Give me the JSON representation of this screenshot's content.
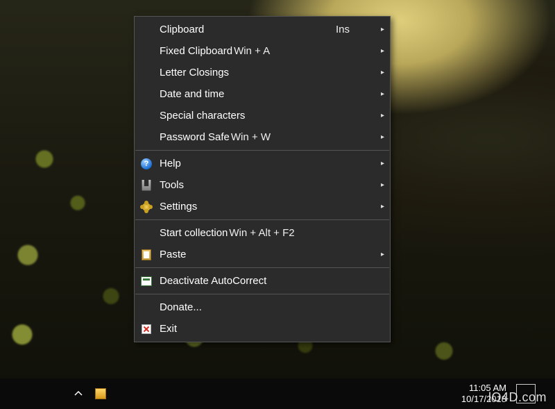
{
  "menu": {
    "items": [
      {
        "label": "Clipboard",
        "shortcut": "Ins",
        "submenu": true,
        "icon": null
      },
      {
        "label": "Fixed Clipboard",
        "shortcut": "Win + A",
        "submenu": true,
        "icon": null
      },
      {
        "label": "Letter Closings",
        "shortcut": "",
        "submenu": true,
        "icon": null
      },
      {
        "label": "Date and time",
        "shortcut": "",
        "submenu": true,
        "icon": null
      },
      {
        "label": "Special characters",
        "shortcut": "",
        "submenu": true,
        "icon": null
      },
      {
        "label": "Password Safe",
        "shortcut": "Win + W",
        "submenu": true,
        "icon": null
      }
    ],
    "items2": [
      {
        "label": "Help",
        "shortcut": "",
        "submenu": true,
        "icon": "help"
      },
      {
        "label": "Tools",
        "shortcut": "",
        "submenu": true,
        "icon": "tools"
      },
      {
        "label": "Settings",
        "shortcut": "",
        "submenu": true,
        "icon": "settings"
      }
    ],
    "items3": [
      {
        "label": "Start collection",
        "shortcut": "Win + Alt + F2",
        "submenu": false,
        "icon": null
      },
      {
        "label": "Paste",
        "shortcut": "",
        "submenu": true,
        "icon": "paste"
      }
    ],
    "items4": [
      {
        "label": "Deactivate AutoCorrect",
        "shortcut": "",
        "submenu": false,
        "icon": "deactivate"
      }
    ],
    "items5": [
      {
        "label": "Donate...",
        "shortcut": "",
        "submenu": false,
        "icon": null
      },
      {
        "label": "Exit",
        "shortcut": "",
        "submenu": false,
        "icon": "exit"
      }
    ]
  },
  "taskbar": {
    "time": "11:05 AM",
    "date": "10/17/2018"
  },
  "watermark": "lO4D.com",
  "icons": {
    "help": "help-icon",
    "tools": "tools-icon",
    "settings": "settings-gears-icon",
    "paste": "paste-icon",
    "deactivate": "deactivate-icon",
    "exit": "exit-x-icon",
    "submenu_arrow": "▸"
  }
}
